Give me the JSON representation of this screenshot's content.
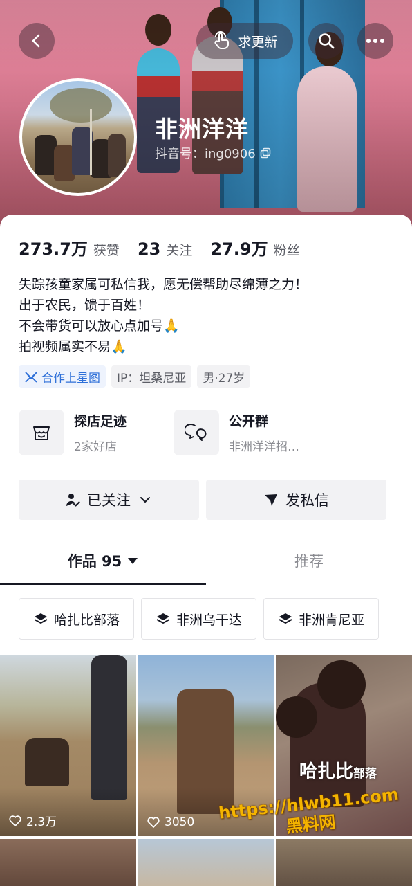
{
  "header": {
    "request_update_label": "求更新",
    "profile_name": "非洲洋洋",
    "douyin_id_label": "抖音号：ing0906"
  },
  "stats": [
    {
      "value": "273.7万",
      "label": "获赞"
    },
    {
      "value": "23",
      "label": "关注"
    },
    {
      "value": "27.9万",
      "label": "粉丝"
    }
  ],
  "bio": [
    "失踪孩童家属可私信我，愿无偿帮助尽绵薄之力！",
    "出于农民，馈于百姓！",
    "不会带货可以放心点加号🙏",
    "拍视频属实不易🙏"
  ],
  "tags": {
    "star_map": "合作上星图",
    "ip": "IP：坦桑尼亚",
    "gender_age": "男·27岁"
  },
  "features": {
    "store": {
      "title": "探店足迹",
      "subtitle": "2家好店"
    },
    "group": {
      "title": "公开群",
      "subtitle": "非洲洋洋招…"
    }
  },
  "actions": {
    "followed_label": "已关注",
    "message_label": "发私信"
  },
  "tabs": {
    "works_label": "作品 95",
    "recommend_label": "推荐"
  },
  "collections": [
    "哈扎比部落",
    "非洲乌干达",
    "非洲肯尼亚"
  ],
  "videos": [
    {
      "likes": "2.3万"
    },
    {
      "likes": "3050"
    },
    {
      "title": "哈扎比",
      "title_suffix": "部落"
    }
  ],
  "watermark": {
    "url": "https://hlwb11.com",
    "site": "黑料网"
  },
  "colors": {
    "accent_blue": "#2d6fd8",
    "watermark": "#f4b400"
  }
}
